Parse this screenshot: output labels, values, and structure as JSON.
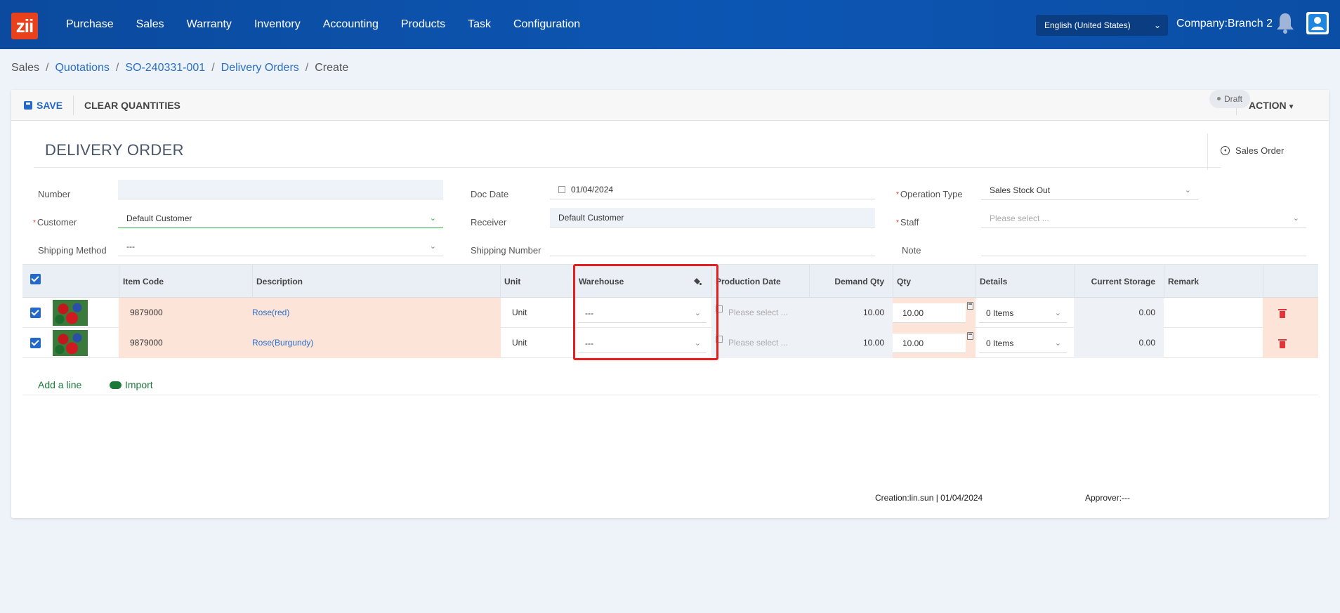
{
  "app": {
    "logo_text": "zii",
    "nav": [
      "Purchase",
      "Sales",
      "Warranty",
      "Inventory",
      "Accounting",
      "Products",
      "Task",
      "Configuration"
    ],
    "language": "English (United States)",
    "company": "Company:Branch 2"
  },
  "breadcrumb": {
    "root": "Sales",
    "quotations": "Quotations",
    "so": "SO-240331-001",
    "delivery_orders": "Delivery Orders",
    "current": "Create",
    "sep": "/"
  },
  "toolbar": {
    "save": "SAVE",
    "clear": "CLEAR QUANTITIES",
    "action": "ACTION"
  },
  "form": {
    "title": "DELIVERY ORDER",
    "sales_order_link": "Sales Order",
    "status": "Draft",
    "labels": {
      "number": "Number",
      "customer": "Customer",
      "shipping_method": "Shipping Method",
      "doc_date": "Doc Date",
      "receiver": "Receiver",
      "shipping_number": "Shipping Number",
      "operation_type": "Operation Type",
      "staff": "Staff",
      "note": "Note"
    },
    "values": {
      "number": "",
      "customer": "Default Customer",
      "shipping_method": "---",
      "doc_date": "01/04/2024",
      "receiver": "Default Customer",
      "shipping_number": "",
      "operation_type": "Sales Stock Out",
      "staff_placeholder": "Please select ...",
      "note": ""
    }
  },
  "table": {
    "headers": {
      "item_code": "Item Code",
      "description": "Description",
      "unit": "Unit",
      "warehouse": "Warehouse",
      "production_date": "Production Date",
      "demand_qty": "Demand Qty",
      "qty": "Qty",
      "details": "Details",
      "current_storage": "Current Storage",
      "remark": "Remark"
    },
    "rows": [
      {
        "item_code": "9879000",
        "description": "Rose(red)",
        "unit": "Unit",
        "warehouse": "---",
        "production_date_placeholder": "Please select ...",
        "demand_qty": "10.00",
        "qty": "10.00",
        "details": "0 Items",
        "current_storage": "0.00",
        "remark": ""
      },
      {
        "item_code": "9879000",
        "description": "Rose(Burgundy)",
        "unit": "Unit",
        "warehouse": "---",
        "production_date_placeholder": "Please select ...",
        "demand_qty": "10.00",
        "qty": "10.00",
        "details": "0 Items",
        "current_storage": "0.00",
        "remark": ""
      }
    ],
    "add_line": "Add a line",
    "import": "Import"
  },
  "footer": {
    "creation": "Creation:lin.sun | 01/04/2024",
    "approver": "Approver:---"
  },
  "colors": {
    "navbar": "#0c56b3",
    "accent": "#2468c9",
    "highlight_box": "#e51f1f",
    "row_peach": "#fde4d8",
    "link_green": "#1b7a3a"
  }
}
